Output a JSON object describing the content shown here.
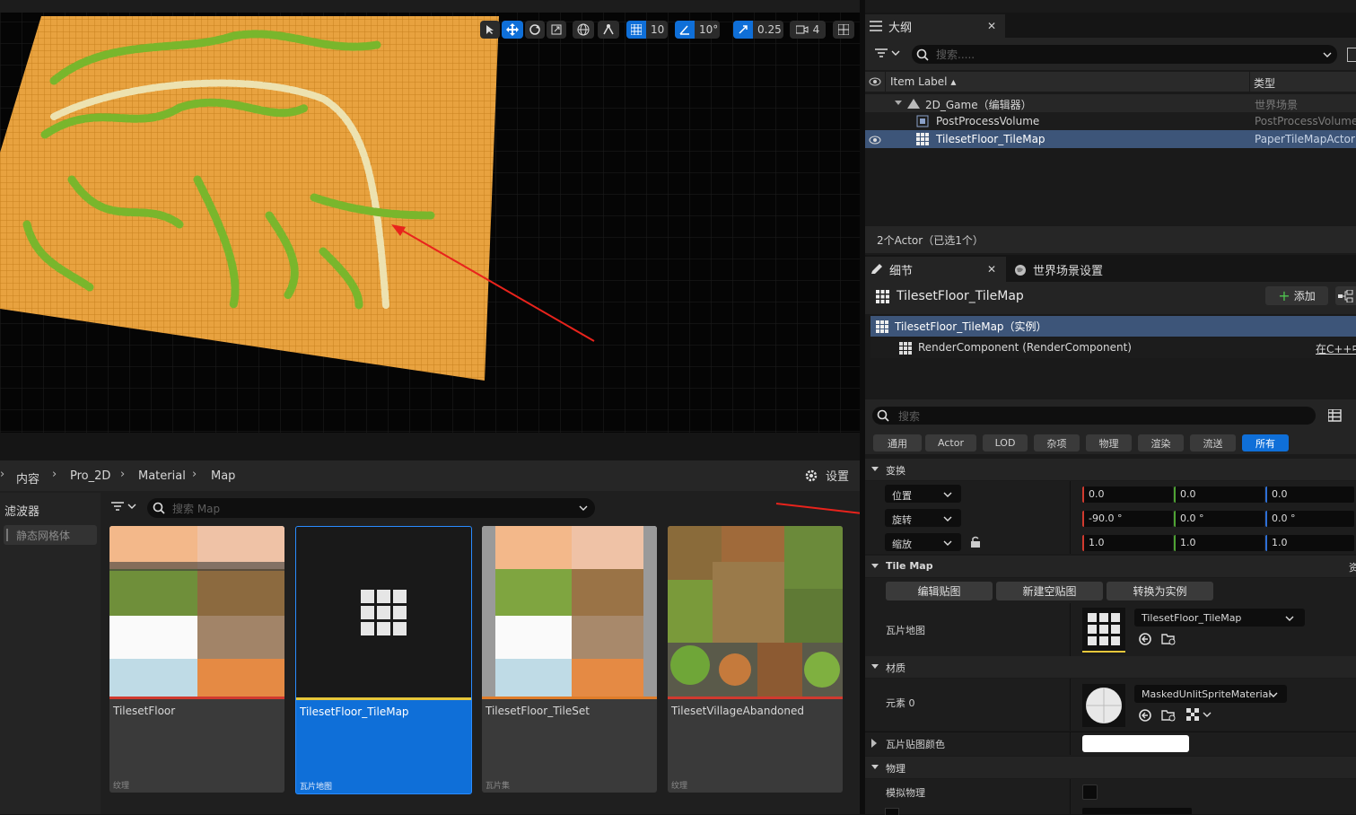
{
  "viewport": {
    "toolbar": {
      "grid_snap": "10",
      "rotate_snap": "10°",
      "scale_snap": "0.25",
      "camera_speed": "4"
    }
  },
  "content_browser": {
    "breadcrumb": [
      "内容",
      "Pro_2D",
      "Material",
      "Map"
    ],
    "settings_label": "设置",
    "filters_title": "滤波器",
    "filter_item": "静态网格体",
    "search_placeholder": "搜索 Map",
    "assets": [
      {
        "name": "TilesetFloor",
        "type": "纹理"
      },
      {
        "name": "TilesetFloor_TileMap",
        "type": "瓦片地图"
      },
      {
        "name": "TilesetFloor_TileSet",
        "type": "瓦片集"
      },
      {
        "name": "TilesetVillageAbandoned",
        "type": "纹理"
      }
    ]
  },
  "outliner": {
    "tab_title": "大纲",
    "search_placeholder": "搜索.....",
    "col_label": "Item Label ▴",
    "col_type": "类型",
    "rows": [
      {
        "label": "2D_Game（编辑器）",
        "type": "世界场景"
      },
      {
        "label": "PostProcessVolume",
        "type": "PostProcessVolume"
      },
      {
        "label": "TilesetFloor_TileMap",
        "type": "PaperTileMapActor"
      }
    ],
    "status": "2个Actor（已选1个）"
  },
  "details": {
    "tab_title": "细节",
    "tab2_title": "世界场景设置",
    "actor_name": "TilesetFloor_TileMap",
    "add_label": "添加",
    "components": [
      {
        "label": "TilesetFloor_TileMap（实例）"
      },
      {
        "label": "RenderComponent (RenderComponent)"
      }
    ],
    "cpp_link": "在C++中",
    "search_placeholder": "搜索",
    "filter_tabs": [
      "通用",
      "Actor",
      "LOD",
      "杂项",
      "物理",
      "渲染",
      "流送",
      "所有"
    ],
    "transform": {
      "section": "变换",
      "location": {
        "label": "位置",
        "x": "0.0",
        "y": "0.0",
        "z": "0.0"
      },
      "rotation": {
        "label": "旋转",
        "x": "-90.0 °",
        "y": "0.0 °",
        "z": "0.0 °"
      },
      "scale": {
        "label": "缩放",
        "x": "1.0",
        "y": "1.0",
        "z": "1.0"
      }
    },
    "tilemap": {
      "section": "Tile Map",
      "side_label": "资",
      "buttons": [
        "编辑贴图",
        "新建空贴图",
        "转换为实例"
      ],
      "prop_label": "瓦片地图",
      "value": "TilesetFloor_TileMap"
    },
    "material": {
      "section": "材质",
      "element_label": "元素 0",
      "value": "MaskedUnlitSpriteMaterial"
    },
    "tile_color_label": "瓦片贴图颜色",
    "physics": {
      "section": "物理",
      "simulate_label": "模拟物理"
    }
  },
  "colors": {
    "accent": "#0f6fd8",
    "tile_orange": "#e8a23f",
    "tile_green": "#79b62c",
    "arrow": "#e8231c"
  }
}
